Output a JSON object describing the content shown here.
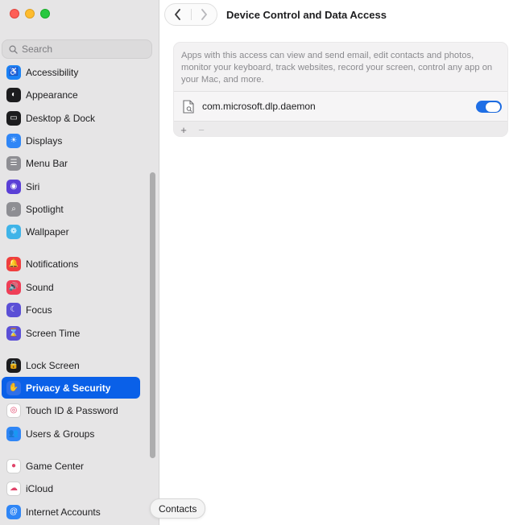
{
  "window": {
    "traffic_lights": [
      "close",
      "minimize",
      "zoom"
    ]
  },
  "sidebar": {
    "search_placeholder": "Search",
    "items": [
      {
        "label": "Accessibility",
        "icon": "accessibility-icon",
        "color": "#1a82f5",
        "glyph": "♿",
        "selected": false
      },
      {
        "label": "Appearance",
        "icon": "appearance-icon",
        "color": "#1c1c1e",
        "glyph": "◐",
        "selected": false
      },
      {
        "label": "Desktop & Dock",
        "icon": "desktop-dock-icon",
        "color": "#1c1c1e",
        "glyph": "▭",
        "selected": false
      },
      {
        "label": "Displays",
        "icon": "displays-icon",
        "color": "#2f86f6",
        "glyph": "☀",
        "selected": false
      },
      {
        "label": "Menu Bar",
        "icon": "menu-bar-icon",
        "color": "#8e8e93",
        "glyph": "☰",
        "selected": false
      },
      {
        "label": "Siri",
        "icon": "siri-icon",
        "color": "#5a3fd6",
        "glyph": "◉",
        "selected": false
      },
      {
        "label": "Spotlight",
        "icon": "spotlight-icon",
        "color": "#8e8e93",
        "glyph": "⌕",
        "selected": false
      },
      {
        "label": "Wallpaper",
        "icon": "wallpaper-icon",
        "color": "#3fb4e8",
        "glyph": "❁",
        "selected": false
      },
      {
        "label": "Notifications",
        "icon": "notifications-icon",
        "color": "#ef3e3e",
        "glyph": "🔔",
        "selected": false
      },
      {
        "label": "Sound",
        "icon": "sound-icon",
        "color": "#ef3e57",
        "glyph": "🔊",
        "selected": false
      },
      {
        "label": "Focus",
        "icon": "focus-icon",
        "color": "#5b4fd6",
        "glyph": "☾",
        "selected": false
      },
      {
        "label": "Screen Time",
        "icon": "screen-time-icon",
        "color": "#5b4fd6",
        "glyph": "⌛",
        "selected": false
      },
      {
        "label": "Lock Screen",
        "icon": "lock-screen-icon",
        "color": "#1c1c1e",
        "glyph": "🔒",
        "selected": false
      },
      {
        "label": "Privacy & Security",
        "icon": "privacy-hand-icon",
        "color": "#2f6fe8",
        "glyph": "✋",
        "selected": true
      },
      {
        "label": "Touch ID & Password",
        "icon": "touch-id-icon",
        "color": "#ffffff",
        "glyph": "◎",
        "selected": false
      },
      {
        "label": "Users & Groups",
        "icon": "users-groups-icon",
        "color": "#2f86f6",
        "glyph": "👥",
        "selected": false
      },
      {
        "label": "Game Center",
        "icon": "game-center-icon",
        "color": "#ffffff",
        "glyph": "●",
        "selected": false
      },
      {
        "label": "iCloud",
        "icon": "icloud-icon",
        "color": "#ffffff",
        "glyph": "☁",
        "selected": false
      },
      {
        "label": "Internet Accounts",
        "icon": "internet-accounts-icon",
        "color": "#2f86f6",
        "glyph": "@",
        "selected": false
      }
    ]
  },
  "toolbar": {
    "title": "Device Control and Data Access",
    "back": "back-chevron-icon",
    "forward": "forward-chevron-icon"
  },
  "panel": {
    "description": "Apps with this access can view and send email, edit contacts and photos, monitor your keyboard, track websites, record your screen, control any app on your Mac, and more.",
    "apps": [
      {
        "name": "com.microsoft.dlp.daemon",
        "enabled": true
      }
    ],
    "add": "+",
    "remove": "−"
  },
  "tooltip": {
    "text": "Contacts"
  },
  "colors": {
    "accent": "#0a60e8",
    "toggle_on": "#1f6fe6"
  }
}
